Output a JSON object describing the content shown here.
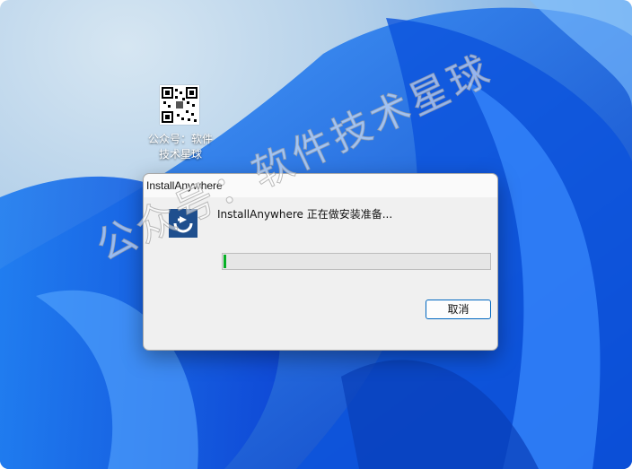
{
  "desktop": {
    "icons": [
      {
        "label": "公众号：软件技术星球",
        "icon": "qr-code-icon"
      }
    ]
  },
  "dialog": {
    "title": "InstallAnywhere",
    "message": "InstallAnywhere 正在做安装准备...",
    "progress": 0.01,
    "cancel_label": "取消",
    "app_icon": "installanywhere-icon"
  },
  "watermark": {
    "text": "公众号：软件技术星球"
  },
  "colors": {
    "progress_fill": "#06b025",
    "button_border": "#0067c0",
    "app_icon_bg": "#1f4f8e"
  }
}
